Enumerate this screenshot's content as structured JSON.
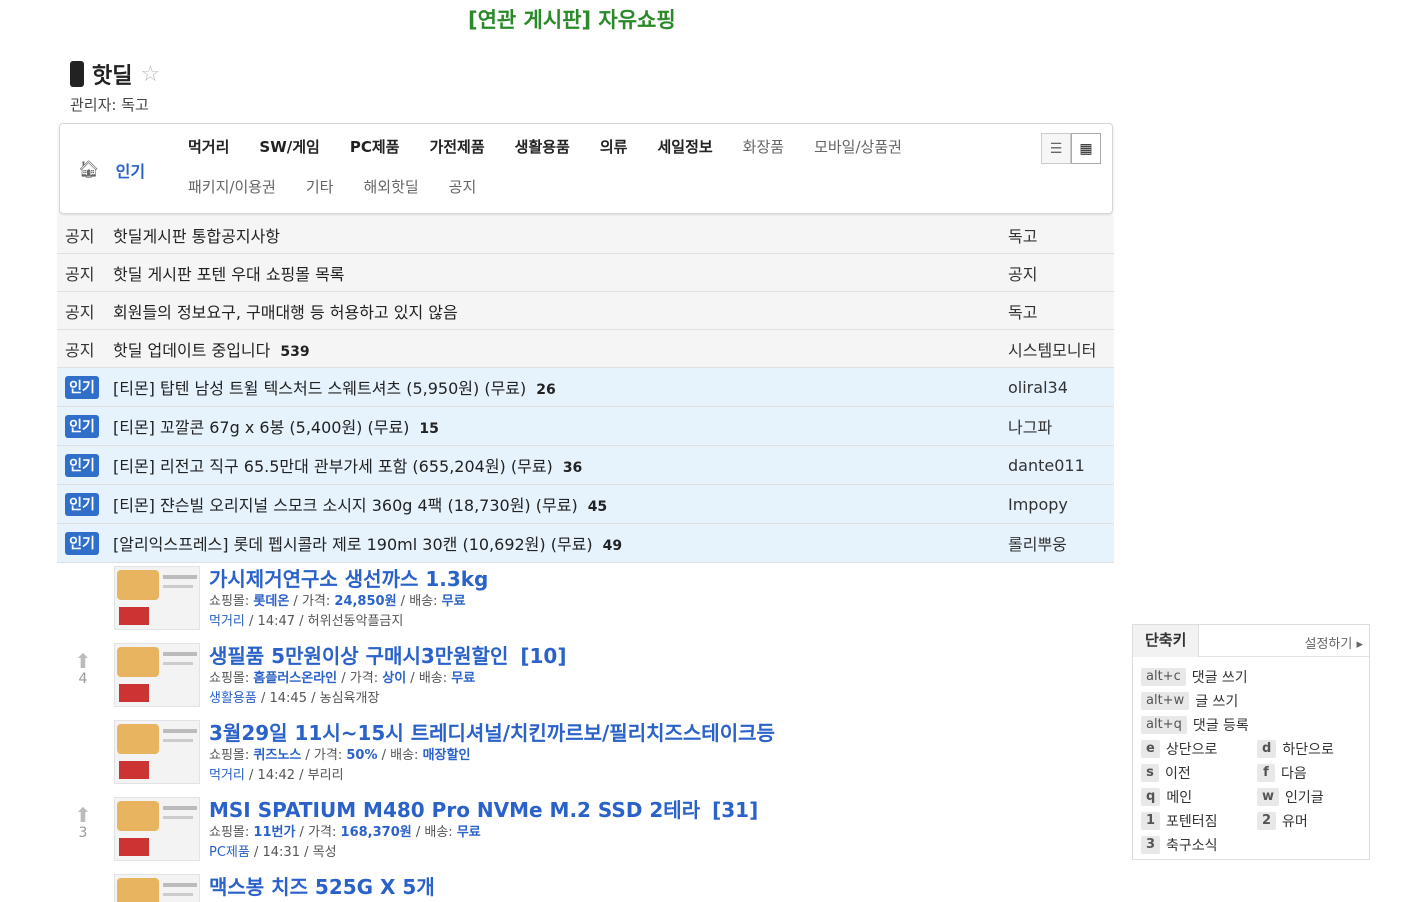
{
  "related": "[연관 게시판] 자유쇼핑",
  "board": {
    "name": "핫딜",
    "admin": "관리자: 독고"
  },
  "nav": {
    "popular": "인기",
    "categories": [
      {
        "label": "먹거리",
        "bold": true
      },
      {
        "label": "SW/게임",
        "bold": true
      },
      {
        "label": "PC제품",
        "bold": true
      },
      {
        "label": "가전제품",
        "bold": true
      },
      {
        "label": "생활용품",
        "bold": true
      },
      {
        "label": "의류",
        "bold": true
      },
      {
        "label": "세일정보",
        "bold": true
      },
      {
        "label": "화장품",
        "bold": false
      },
      {
        "label": "모바일/상품권",
        "bold": false
      },
      {
        "label": "패키지/이용권",
        "bold": false
      },
      {
        "label": "기타",
        "bold": false
      },
      {
        "label": "해외핫딜",
        "bold": false
      },
      {
        "label": "공지",
        "bold": false
      }
    ]
  },
  "notices": [
    {
      "tag": "공지",
      "title": "핫딜게시판 통합공지사항",
      "count": "",
      "author": "독고"
    },
    {
      "tag": "공지",
      "title": "핫딜 게시판 포텐 우대 쇼핑몰 목록",
      "count": "",
      "author": "공지"
    },
    {
      "tag": "공지",
      "title": "회원들의 정보요구, 구매대행 등 허용하고 있지 않음",
      "count": "",
      "author": "독고"
    },
    {
      "tag": "공지",
      "title": "핫딜 업데이트 중입니다",
      "count": "539",
      "author": "시스템모니터"
    }
  ],
  "hot": [
    {
      "tag": "인기",
      "title": "[티몬] 탑텐 남성 트윌 텍스처드 스웨트셔츠 (5,950원) (무료)",
      "count": "26",
      "author": "oliral34"
    },
    {
      "tag": "인기",
      "title": "[티몬] 꼬깔콘 67g x 6봉 (5,400원) (무료)",
      "count": "15",
      "author": "나그파"
    },
    {
      "tag": "인기",
      "title": "[티몬] 리전고 직구 65.5만대 관부가세 포함 (655,204원) (무료)",
      "count": "36",
      "author": "dante011"
    },
    {
      "tag": "인기",
      "title": "[티몬] 쟌슨빌 오리지널 스모크 소시지 360g 4팩 (18,730원) (무료)",
      "count": "45",
      "author": "Impopy"
    },
    {
      "tag": "인기",
      "title": "[알리익스프레스] 롯데 펩시콜라 제로 190ml 30캔 (10,692원) (무료)",
      "count": "49",
      "author": "롤리뿌웅"
    }
  ],
  "deals": [
    {
      "vote": "",
      "title": "가시제거연구소 생선까스 1.3kg",
      "comments": "",
      "mall_label": "쇼핑몰:",
      "mall": "롯데온",
      "price_label": "가격:",
      "price": "24,850원",
      "ship_label": "배송:",
      "ship": "무료",
      "category": "먹거리",
      "time": "14:47",
      "author": "허위선동악플금지"
    },
    {
      "vote": "4",
      "title": "생필품 5만원이상 구매시3만원할인",
      "comments": "[10]",
      "mall_label": "쇼핑몰:",
      "mall": "홈플러스온라인",
      "price_label": "가격:",
      "price": "상이",
      "ship_label": "배송:",
      "ship": "무료",
      "category": "생활용품",
      "time": "14:45",
      "author": "농심육개장"
    },
    {
      "vote": "",
      "title": "3월29일 11시~15시 트레디셔널/치킨까르보/필리치즈스테이크등",
      "comments": "",
      "mall_label": "쇼핑몰:",
      "mall": "퀴즈노스",
      "price_label": "가격:",
      "price": "50%",
      "ship_label": "배송:",
      "ship": "매장할인",
      "category": "먹거리",
      "time": "14:42",
      "author": "부리리"
    },
    {
      "vote": "3",
      "title": "MSI SPATIUM M480 Pro NVMe M.2 SSD 2테라",
      "comments": "[31]",
      "mall_label": "쇼핑몰:",
      "mall": "11번가",
      "price_label": "가격:",
      "price": "168,370원",
      "ship_label": "배송:",
      "ship": "무료",
      "category": "PC제품",
      "time": "14:31",
      "author": "목성"
    },
    {
      "vote": "",
      "title": "맥스봉 치즈 525G X 5개",
      "comments": "",
      "mall_label": "",
      "mall": "",
      "price_label": "",
      "price": "",
      "ship_label": "",
      "ship": "",
      "category": "",
      "time": "",
      "author": ""
    }
  ],
  "shortcut": {
    "title": "단축키",
    "settings": "설정하기",
    "combo": [
      {
        "key": "alt+c",
        "label": "댓글 쓰기"
      },
      {
        "key": "alt+w",
        "label": "글 쓰기"
      },
      {
        "key": "alt+q",
        "label": "댓글 등록"
      }
    ],
    "single": [
      {
        "key": "e",
        "label": "상단으로"
      },
      {
        "key": "d",
        "label": "하단으로"
      },
      {
        "key": "s",
        "label": "이전"
      },
      {
        "key": "f",
        "label": "다음"
      },
      {
        "key": "q",
        "label": "메인"
      },
      {
        "key": "w",
        "label": "인기글"
      },
      {
        "key": "1",
        "label": "포텐터짐"
      },
      {
        "key": "2",
        "label": "유머"
      },
      {
        "key": "3",
        "label": "축구소식"
      }
    ]
  }
}
